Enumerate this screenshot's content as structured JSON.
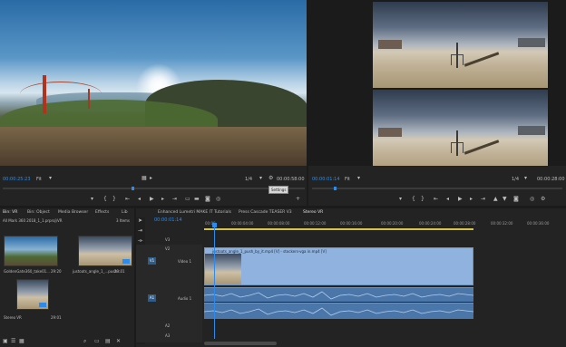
{
  "source_monitor": {
    "timecode": "00:00:25:23",
    "fit": "Fit",
    "fraction": "1/4",
    "duration": "00:00:58:00",
    "tooltip": "Settings"
  },
  "program_monitor": {
    "timecode": "00:00:01:14",
    "fit": "Fit",
    "fraction": "1/4",
    "duration": "00:00:28:00"
  },
  "project": {
    "tabs": [
      "Bin: VR",
      "Bin: Object",
      "Media Browser",
      "Effects",
      "Lib"
    ],
    "path": "All Mark 360 2018_1_1.prproj\\VR",
    "count": "3 Items",
    "items": [
      {
        "name": "GoldenGate360_take01...",
        "duration": "29:20"
      },
      {
        "name": "justoats_angle_1_...push...",
        "duration": "29:01"
      },
      {
        "name": "Stereo VR",
        "duration": "29:01"
      }
    ]
  },
  "timeline": {
    "tabs": [
      "Enhanced Lumetri MAKE IT Tutorials",
      "Press Cascade TEASER V3",
      "Stereo VR"
    ],
    "timecode": "00:00:01:14",
    "ruler": [
      "00:00",
      "00:00:04:00",
      "00:00:08:00",
      "00:00:12:00",
      "00:00:16:00",
      "00:00:20:00",
      "00:00:24:00",
      "00:00:28:00",
      "00:00:32:00",
      "00:00:36:00"
    ],
    "tracks": [
      {
        "sel": "",
        "name": "V3"
      },
      {
        "sel": "",
        "name": "V2"
      },
      {
        "sel": "V1",
        "name": "Video 1"
      },
      {
        "sel": "A1",
        "name": "Audio 1"
      },
      {
        "sel": "",
        "name": "A2"
      },
      {
        "sel": "",
        "name": "A3"
      }
    ],
    "clip_name": "justoats_angle_1_push_by_it.mp4 [V] - stockers-vga in.mp4 [V]"
  }
}
